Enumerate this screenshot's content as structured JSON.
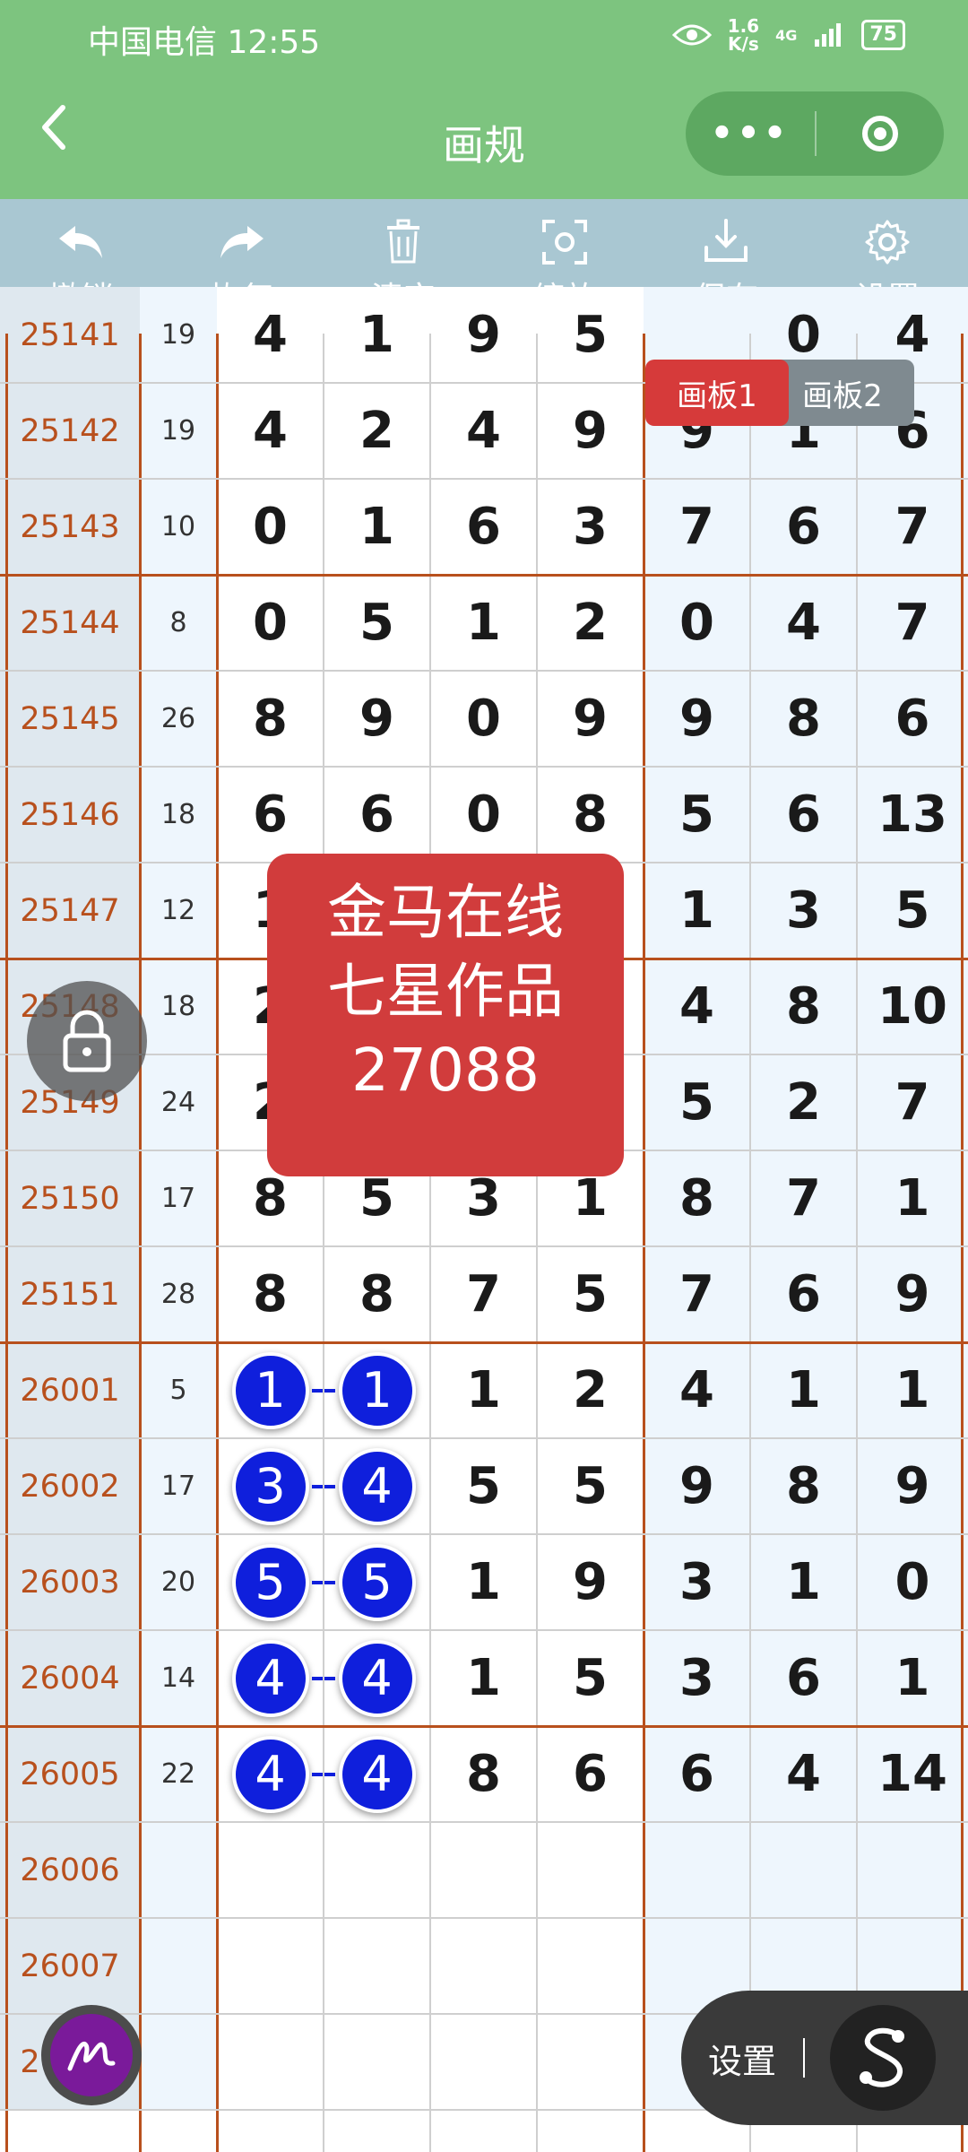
{
  "status_bar": {
    "carrier": "中国电信 12:55",
    "speed_top": "1.6",
    "speed_bottom": "K/s",
    "network": "4G",
    "battery": "75"
  },
  "nav": {
    "title": "画规"
  },
  "toolbar": [
    {
      "label": "撤销",
      "icon": "undo-icon"
    },
    {
      "label": "恢复",
      "icon": "redo-icon"
    },
    {
      "label": "清空",
      "icon": "trash-icon"
    },
    {
      "label": "缩放",
      "icon": "zoom-icon"
    },
    {
      "label": "保存",
      "icon": "download-icon"
    },
    {
      "label": "设置",
      "icon": "gear-icon"
    }
  ],
  "tabs": {
    "board1": "画板1",
    "board2": "画板2"
  },
  "rows": [
    {
      "issue": "25141",
      "sum": "19",
      "nums": [
        "4",
        "1",
        "9",
        "5",
        "",
        "0",
        "4"
      ]
    },
    {
      "issue": "25142",
      "sum": "19",
      "nums": [
        "4",
        "2",
        "4",
        "9",
        "9",
        "1",
        "6"
      ]
    },
    {
      "issue": "25143",
      "sum": "10",
      "nums": [
        "0",
        "1",
        "6",
        "3",
        "7",
        "6",
        "7"
      ]
    },
    {
      "issue": "25144",
      "sum": "8",
      "nums": [
        "0",
        "5",
        "1",
        "2",
        "0",
        "4",
        "7"
      ]
    },
    {
      "issue": "25145",
      "sum": "26",
      "nums": [
        "8",
        "9",
        "0",
        "9",
        "9",
        "8",
        "6"
      ]
    },
    {
      "issue": "25146",
      "sum": "18",
      "nums": [
        "6",
        "6",
        "0",
        "8",
        "5",
        "6",
        "13"
      ]
    },
    {
      "issue": "25147",
      "sum": "12",
      "nums": [
        "1",
        "",
        "",
        "",
        "1",
        "3",
        "5"
      ]
    },
    {
      "issue": "25148",
      "sum": "18",
      "nums": [
        "2",
        "",
        "",
        "",
        "4",
        "8",
        "10"
      ]
    },
    {
      "issue": "25149",
      "sum": "24",
      "nums": [
        "2",
        "",
        "",
        "",
        "5",
        "2",
        "7"
      ]
    },
    {
      "issue": "25150",
      "sum": "17",
      "nums": [
        "8",
        "5",
        "3",
        "1",
        "8",
        "7",
        "1"
      ]
    },
    {
      "issue": "25151",
      "sum": "28",
      "nums": [
        "8",
        "8",
        "7",
        "5",
        "7",
        "6",
        "9"
      ]
    },
    {
      "issue": "26001",
      "sum": "5",
      "nums": [
        "1",
        "1",
        "1",
        "2",
        "4",
        "1",
        "1"
      ],
      "balls": true
    },
    {
      "issue": "26002",
      "sum": "17",
      "nums": [
        "3",
        "4",
        "5",
        "5",
        "9",
        "8",
        "9"
      ],
      "balls": true
    },
    {
      "issue": "26003",
      "sum": "20",
      "nums": [
        "5",
        "5",
        "1",
        "9",
        "3",
        "1",
        "0"
      ],
      "balls": true
    },
    {
      "issue": "26004",
      "sum": "14",
      "nums": [
        "4",
        "4",
        "1",
        "5",
        "3",
        "6",
        "1"
      ],
      "balls": true
    },
    {
      "issue": "26005",
      "sum": "22",
      "nums": [
        "4",
        "4",
        "8",
        "6",
        "6",
        "4",
        "14"
      ],
      "balls": true
    },
    {
      "issue": "26006",
      "sum": "",
      "nums": [
        "",
        "",
        "",
        "",
        "",
        "",
        ""
      ]
    },
    {
      "issue": "26007",
      "sum": "",
      "nums": [
        "",
        "",
        "",
        "",
        "",
        "",
        ""
      ]
    },
    {
      "issue": "26008",
      "sum": "",
      "nums": [
        "",
        "",
        "",
        "",
        "",
        "",
        ""
      ]
    }
  ],
  "overlay": {
    "line1": "金马在线",
    "line2": "七星作品",
    "line3": "27088"
  },
  "floating": {
    "settings_label": "设置"
  },
  "colors": {
    "header": "#7dc47f",
    "toolbar": "#a9c7d2",
    "issue_text": "#b8501d",
    "ball": "#0f1fdc",
    "overlay": "#d13c3c"
  }
}
